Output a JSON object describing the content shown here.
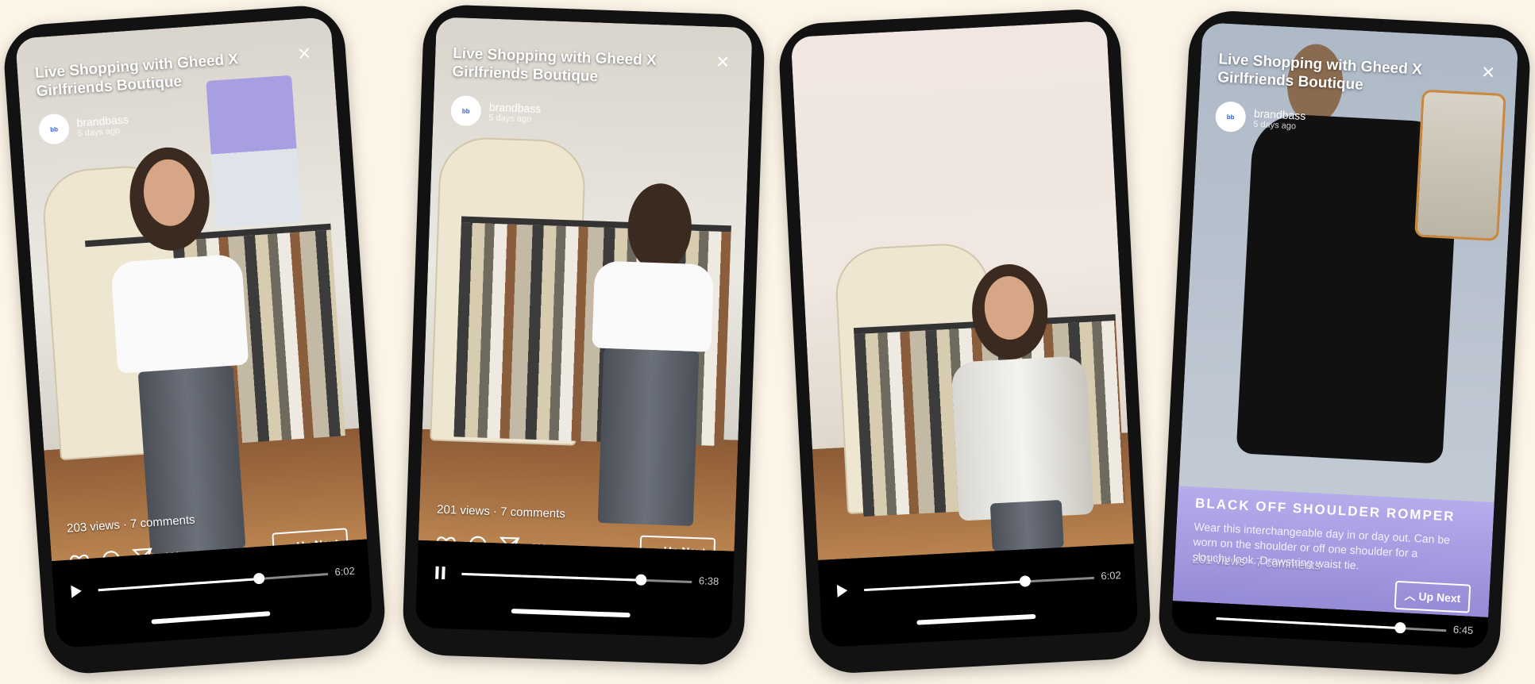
{
  "phones": [
    {
      "title": "Live Shopping with Gheed X Girlfriends Boutique",
      "brand": "brandbass",
      "time": "5 days ago",
      "stats": "203 views · 7 comments",
      "upnext": "Up Next",
      "duration": "6:02",
      "progress": 0.7,
      "state": "play"
    },
    {
      "title": "Live Shopping with Gheed X Girlfriends Boutique",
      "brand": "brandbass",
      "time": "5 days ago",
      "stats": "201 views · 7 comments",
      "upnext": "Up Next",
      "duration": "6:38",
      "progress": 0.78,
      "state": "pause"
    },
    {
      "duration": "6:02",
      "progress": 0.7,
      "state": "play"
    },
    {
      "title": "Live Shopping with Gheed X Girlfriends Boutique",
      "brand": "brandbass",
      "time": "5 days ago",
      "stats": "201 views · 7 comments",
      "upnext": "Up Next",
      "duration": "6:45",
      "progress": 0.8,
      "state": "play",
      "promo_title": "BLACK OFF SHOULDER ROMPER",
      "promo_text": "Wear this interchangeable day in or day out. Can be worn on the shoulder or off one shoulder for a slouchy look. Drawstring waist tie."
    }
  ],
  "icons": [
    "heart-icon",
    "comment-icon",
    "send-icon",
    "more-icon",
    "close-icon",
    "play-icon",
    "pause-icon",
    "chevron-up-icon"
  ]
}
